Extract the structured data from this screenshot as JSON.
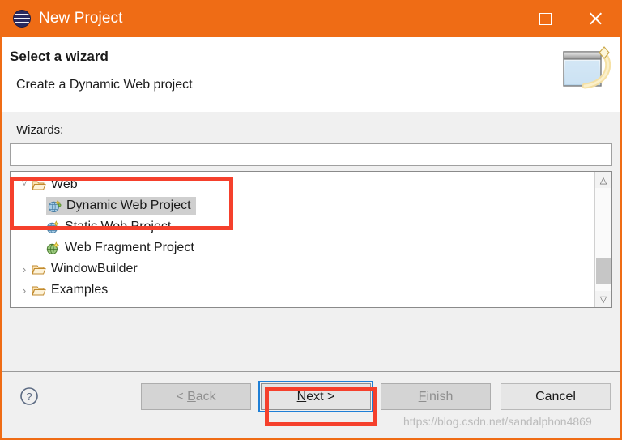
{
  "window": {
    "title": "New Project",
    "app_icon": "eclipse-icon",
    "accent_color": "#ef6c15",
    "controls": {
      "minimize": "minimize-icon",
      "maximize": "maximize-icon",
      "close": "close-icon"
    }
  },
  "header": {
    "title": "Select a wizard",
    "subtitle": "Create a Dynamic Web project",
    "icon": "wizard-window-icon"
  },
  "main": {
    "wizards_label": "Wizards:",
    "wizards_label_mnemonic": "W",
    "search": {
      "value": "",
      "placeholder": ""
    },
    "tree": [
      {
        "label": "Web",
        "icon": "folder-open-icon",
        "level": 0,
        "expanded": true,
        "twisty": "ⱽ",
        "selected": false
      },
      {
        "label": "Dynamic Web Project",
        "icon": "dynamic-web-project-icon",
        "level": 1,
        "expanded": null,
        "twisty": "",
        "selected": true
      },
      {
        "label": "Static Web Project",
        "icon": "static-web-project-icon",
        "level": 1,
        "expanded": null,
        "twisty": "",
        "selected": false
      },
      {
        "label": "Web Fragment Project",
        "icon": "web-fragment-project-icon",
        "level": 1,
        "expanded": null,
        "twisty": "",
        "selected": false
      },
      {
        "label": "WindowBuilder",
        "icon": "folder-open-icon",
        "level": 0,
        "expanded": false,
        "twisty": "›",
        "selected": false
      },
      {
        "label": "Examples",
        "icon": "folder-open-icon",
        "level": 0,
        "expanded": false,
        "twisty": "›",
        "selected": false
      }
    ],
    "scrollbar": {
      "up_arrow": "chevron-up-icon",
      "down_arrow": "chevron-down-icon"
    }
  },
  "footer": {
    "help_icon": "help-question-icon",
    "buttons": {
      "back": {
        "label": "< Back",
        "mnemonic": "B",
        "enabled": false,
        "focused": false
      },
      "next": {
        "label": "Next >",
        "mnemonic": "N",
        "enabled": true,
        "focused": true
      },
      "finish": {
        "label": "Finish",
        "mnemonic": "F",
        "enabled": false,
        "focused": false
      },
      "cancel": {
        "label": "Cancel",
        "mnemonic": "",
        "enabled": true,
        "focused": false
      }
    }
  },
  "annotations": {
    "color": "#f5402c",
    "highlight_tree_item": "Dynamic Web Project",
    "highlight_button": "Next >"
  },
  "watermark": "https://blog.csdn.net/sandalphon4869"
}
